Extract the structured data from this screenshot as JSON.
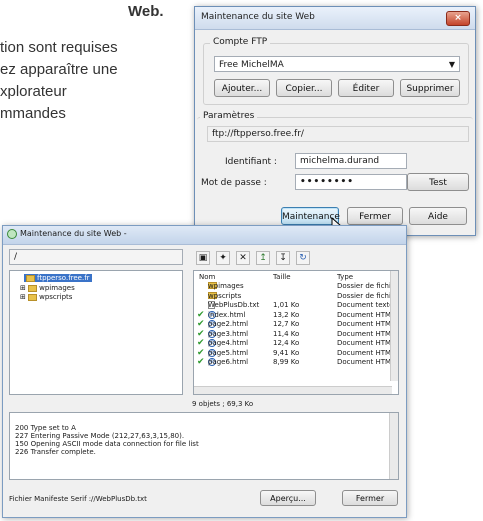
{
  "background_text": {
    "line1": "Web.",
    "line2": "tion sont requises",
    "line3": "ez apparaître une",
    "line4": "xplorateur",
    "line5": "mmandes"
  },
  "dialog1": {
    "title": "Maintenance du site Web",
    "close_icon": "×",
    "ftp_group_label": "Compte FTP",
    "ftp_account_value": "Free MichelMA",
    "buttons": {
      "add": "Ajouter...",
      "copy": "Copier...",
      "edit": "Éditer",
      "delete": "Supprimer"
    },
    "params_group_label": "Paramètres",
    "server": "ftp://ftpperso.free.fr/",
    "login_label": "Identifiant :",
    "login_value": "michelma.durand",
    "password_label": "Mot de passe :",
    "password_value": "••••••••",
    "test_button": "Test",
    "footer_buttons": {
      "maintenance": "Maintenance",
      "close": "Fermer",
      "help": "Aide"
    }
  },
  "dialog2": {
    "title": "Maintenance du site Web -",
    "path_value": "/",
    "toolbar_icons": [
      "folder-up-icon",
      "new-folder-icon",
      "delete-icon",
      "upload-icon",
      "download-icon",
      "refresh-icon"
    ],
    "tree": {
      "root": "ftpperso.free.fr",
      "children": [
        "wpimages",
        "wpscripts"
      ]
    },
    "columns": {
      "name": "Nom",
      "size": "Taille",
      "type": "Type"
    },
    "files": [
      {
        "name": "wpimages",
        "size": "",
        "type": "Dossier de fichie",
        "kind": "folder",
        "checked": false
      },
      {
        "name": "wpscripts",
        "size": "",
        "type": "Dossier de fichie",
        "kind": "folder",
        "checked": false
      },
      {
        "name": "WebPlusDb.txt",
        "size": "1,01 Ko",
        "type": "Document texte",
        "kind": "txt",
        "checked": false
      },
      {
        "name": "index.html",
        "size": "13,2 Ko",
        "type": "Document HTML",
        "kind": "html",
        "checked": true
      },
      {
        "name": "page2.html",
        "size": "12,7 Ko",
        "type": "Document HTML",
        "kind": "html",
        "checked": true
      },
      {
        "name": "page3.html",
        "size": "11,4 Ko",
        "type": "Document HTML",
        "kind": "html",
        "checked": true
      },
      {
        "name": "page4.html",
        "size": "12,4 Ko",
        "type": "Document HTML",
        "kind": "html",
        "checked": true
      },
      {
        "name": "page5.html",
        "size": "9,41 Ko",
        "type": "Document HTML",
        "kind": "html",
        "checked": true
      },
      {
        "name": "page6.html",
        "size": "8,99 Ko",
        "type": "Document HTML",
        "kind": "html",
        "checked": true
      }
    ],
    "status": "9 objets ; 69,3 Ko",
    "log": "200 Type set to A\n227 Entering Passive Mode (212,27,63,3,15,80).\n150 Opening ASCII mode data connection for file list\n226 Transfer complete.",
    "manifest_label": "Fichier Manifeste Serif :",
    "manifest_value": "//WebPlusDb.txt",
    "preview_button": "Aperçu...",
    "close_button": "Fermer"
  }
}
